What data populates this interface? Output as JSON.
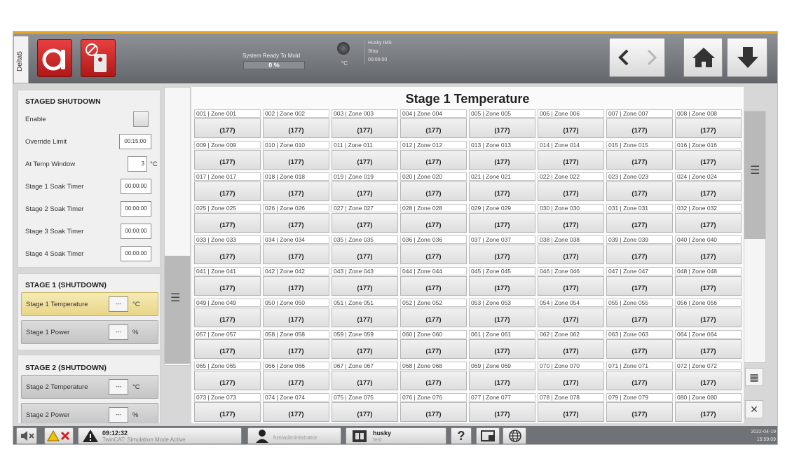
{
  "sidetab": {
    "label": "Delta5"
  },
  "header": {
    "status_text": "System Ready To Mold",
    "progress_label": "0 %",
    "unit_label": "°C",
    "ims_name": "Husky IMS",
    "ims_state": "Stop",
    "ims_time": "00:00:00"
  },
  "staged": {
    "title": "STAGED SHUTDOWN",
    "enable_label": "Enable",
    "override_label": "Override Limit",
    "override_value": "00:15:00",
    "window_label": "At Temp Window",
    "window_value": "3",
    "window_unit": "°C",
    "soak": [
      {
        "label": "Stage 1 Soak Timer",
        "value": "00:00:00"
      },
      {
        "label": "Stage 2 Soak Timer",
        "value": "00:00:00"
      },
      {
        "label": "Stage 3 Soak Timer",
        "value": "00:00:00"
      },
      {
        "label": "Stage 4 Soak Timer",
        "value": "00:00:00"
      }
    ]
  },
  "stage1": {
    "title": "STAGE 1 (SHUTDOWN)",
    "temp_label": "Stage 1 Temperature",
    "temp_value": "---",
    "temp_unit": "°C",
    "power_label": "Stage 1 Power",
    "power_value": "---",
    "power_unit": "%"
  },
  "stage2": {
    "title": "STAGE 2 (SHUTDOWN)",
    "temp_label": "Stage 2 Temperature",
    "temp_value": "---",
    "temp_unit": "°C",
    "power_label": "Stage 2 Power",
    "power_value": "---",
    "power_unit": "%"
  },
  "grid": {
    "title": "Stage 1 Temperature",
    "zones": [
      {
        "name": "001 | Zone 001",
        "value": "(177)"
      },
      {
        "name": "002 | Zone 002",
        "value": "(177)"
      },
      {
        "name": "003 | Zone 003",
        "value": "(177)"
      },
      {
        "name": "004 | Zone 004",
        "value": "(177)"
      },
      {
        "name": "005 | Zone 005",
        "value": "(177)"
      },
      {
        "name": "006 | Zone 006",
        "value": "(177)"
      },
      {
        "name": "007 | Zone 007",
        "value": "(177)"
      },
      {
        "name": "008 | Zone 008",
        "value": "(177)"
      },
      {
        "name": "009 | Zone 009",
        "value": "(177)"
      },
      {
        "name": "010 | Zone 010",
        "value": "(177)"
      },
      {
        "name": "011 | Zone 011",
        "value": "(177)"
      },
      {
        "name": "012 | Zone 012",
        "value": "(177)"
      },
      {
        "name": "013 | Zone 013",
        "value": "(177)"
      },
      {
        "name": "014 | Zone 014",
        "value": "(177)"
      },
      {
        "name": "015 | Zone 015",
        "value": "(177)"
      },
      {
        "name": "016 | Zone 016",
        "value": "(177)"
      },
      {
        "name": "017 | Zone 017",
        "value": "(177)"
      },
      {
        "name": "018 | Zone 018",
        "value": "(177)"
      },
      {
        "name": "019 | Zone 019",
        "value": "(177)"
      },
      {
        "name": "020 | Zone 020",
        "value": "(177)"
      },
      {
        "name": "021 | Zone 021",
        "value": "(177)"
      },
      {
        "name": "022 | Zone 022",
        "value": "(177)"
      },
      {
        "name": "023 | Zone 023",
        "value": "(177)"
      },
      {
        "name": "024 | Zone 024",
        "value": "(177)"
      },
      {
        "name": "025 | Zone 025",
        "value": "(177)"
      },
      {
        "name": "026 | Zone 026",
        "value": "(177)"
      },
      {
        "name": "027 | Zone 027",
        "value": "(177)"
      },
      {
        "name": "028 | Zone 028",
        "value": "(177)"
      },
      {
        "name": "029 | Zone 029",
        "value": "(177)"
      },
      {
        "name": "030 | Zone 030",
        "value": "(177)"
      },
      {
        "name": "031 | Zone 031",
        "value": "(177)"
      },
      {
        "name": "032 | Zone 032",
        "value": "(177)"
      },
      {
        "name": "033 | Zone 033",
        "value": "(177)"
      },
      {
        "name": "034 | Zone 034",
        "value": "(177)"
      },
      {
        "name": "035 | Zone 035",
        "value": "(177)"
      },
      {
        "name": "036 | Zone 036",
        "value": "(177)"
      },
      {
        "name": "037 | Zone 037",
        "value": "(177)"
      },
      {
        "name": "038 | Zone 038",
        "value": "(177)"
      },
      {
        "name": "039 | Zone 039",
        "value": "(177)"
      },
      {
        "name": "040 | Zone 040",
        "value": "(177)"
      },
      {
        "name": "041 | Zone 041",
        "value": "(177)"
      },
      {
        "name": "042 | Zone 042",
        "value": "(177)"
      },
      {
        "name": "043 | Zone 043",
        "value": "(177)"
      },
      {
        "name": "044 | Zone 044",
        "value": "(177)"
      },
      {
        "name": "045 | Zone 045",
        "value": "(177)"
      },
      {
        "name": "046 | Zone 046",
        "value": "(177)"
      },
      {
        "name": "047 | Zone 047",
        "value": "(177)"
      },
      {
        "name": "048 | Zone 048",
        "value": "(177)"
      },
      {
        "name": "049 | Zone 049",
        "value": "(177)"
      },
      {
        "name": "050 | Zone 050",
        "value": "(177)"
      },
      {
        "name": "051 | Zone 051",
        "value": "(177)"
      },
      {
        "name": "052 | Zone 052",
        "value": "(177)"
      },
      {
        "name": "053 | Zone 053",
        "value": "(177)"
      },
      {
        "name": "054 | Zone 054",
        "value": "(177)"
      },
      {
        "name": "055 | Zone 055",
        "value": "(177)"
      },
      {
        "name": "056 | Zone 056",
        "value": "(177)"
      },
      {
        "name": "057 | Zone 057",
        "value": "(177)"
      },
      {
        "name": "058 | Zone 058",
        "value": "(177)"
      },
      {
        "name": "059 | Zone 059",
        "value": "(177)"
      },
      {
        "name": "060 | Zone 060",
        "value": "(177)"
      },
      {
        "name": "061 | Zone 061",
        "value": "(177)"
      },
      {
        "name": "062 | Zone 062",
        "value": "(177)"
      },
      {
        "name": "063 | Zone 063",
        "value": "(177)"
      },
      {
        "name": "064 | Zone 064",
        "value": "(177)"
      },
      {
        "name": "065 | Zone 065",
        "value": "(177)"
      },
      {
        "name": "066 | Zone 066",
        "value": "(177)"
      },
      {
        "name": "067 | Zone 067",
        "value": "(177)"
      },
      {
        "name": "068 | Zone 068",
        "value": "(177)"
      },
      {
        "name": "069 | Zone 069",
        "value": "(177)"
      },
      {
        "name": "070 | Zone 070",
        "value": "(177)"
      },
      {
        "name": "071 | Zone 071",
        "value": "(177)"
      },
      {
        "name": "072 | Zone 072",
        "value": "(177)"
      },
      {
        "name": "073 | Zone 073",
        "value": "(177)"
      },
      {
        "name": "074 | Zone 074",
        "value": "(177)"
      },
      {
        "name": "075 | Zone 075",
        "value": "(177)"
      },
      {
        "name": "076 | Zone 076",
        "value": "(177)"
      },
      {
        "name": "077 | Zone 077",
        "value": "(177)"
      },
      {
        "name": "078 | Zone 078",
        "value": "(177)"
      },
      {
        "name": "079 | Zone 079",
        "value": "(177)"
      },
      {
        "name": "080 | Zone 080",
        "value": "(177)"
      }
    ]
  },
  "footer": {
    "time": "09:12:32",
    "alarm_message": "TwinCAT: Simulation Mode Active",
    "user": "hmiadministrator",
    "mold_name": "husky",
    "mold_sub": "test",
    "help_label": "?",
    "date": "2022-04-19",
    "clock": "15:59:09"
  },
  "icons": {
    "sidetab": "vertical-tab",
    "heater_off": "heater-off-icon",
    "no_power": "no-power-icon",
    "back": "chevron-left-icon",
    "forward": "chevron-right-icon",
    "home": "home-icon",
    "download": "arrow-down-icon",
    "mute": "speaker-mute-icon",
    "alarm_clear": "alarm-clear-icon",
    "warning": "warning-icon",
    "user": "user-icon",
    "mold": "mold-icon",
    "help": "help-icon",
    "screenshot": "screenshot-icon",
    "globe": "globe-icon",
    "menu": "menu-icon",
    "keypad": "keypad-icon",
    "close": "close-icon"
  },
  "colors": {
    "accent_orange": "#e8a524",
    "active_yellow": "#f0e09a",
    "alarm_red": "#d42020"
  }
}
